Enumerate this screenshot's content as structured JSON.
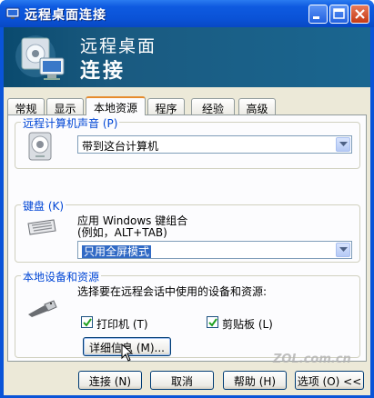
{
  "window": {
    "title": "远程桌面连接"
  },
  "banner": {
    "line1": "远程桌面",
    "line2": "连接"
  },
  "tabs": [
    {
      "label": "常规"
    },
    {
      "label": "显示"
    },
    {
      "label": "本地资源"
    },
    {
      "label": "程序"
    },
    {
      "label": "经验"
    },
    {
      "label": "高级"
    }
  ],
  "active_tab": "本地资源",
  "sound_group": {
    "label": "远程计算机声音 (P)",
    "combo_value": "带到这台计算机"
  },
  "keyboard_group": {
    "label": "键盘 (K)",
    "desc_line1": "应用 Windows 键组合",
    "desc_line2": "(例如，ALT+TAB)",
    "combo_value": "只用全屏模式"
  },
  "devices_group": {
    "label": "本地设备和资源",
    "desc": "选择要在远程会话中使用的设备和资源:",
    "printer_label": "打印机 (T)",
    "printer_checked": true,
    "clipboard_label": "剪贴板 (L)",
    "clipboard_checked": true,
    "details_button": "详细信息 (M)..."
  },
  "footer": {
    "connect": "连接 (N)",
    "cancel": "取消",
    "help": "帮助 (H)",
    "options": "选项 (O) <<"
  },
  "watermark": "ZOL.com.cn",
  "colors": {
    "titlebar": "#0a52d6",
    "group_label": "#0046d5",
    "selection": "#316ac5",
    "active_tab_accent": "#e68b2c"
  }
}
